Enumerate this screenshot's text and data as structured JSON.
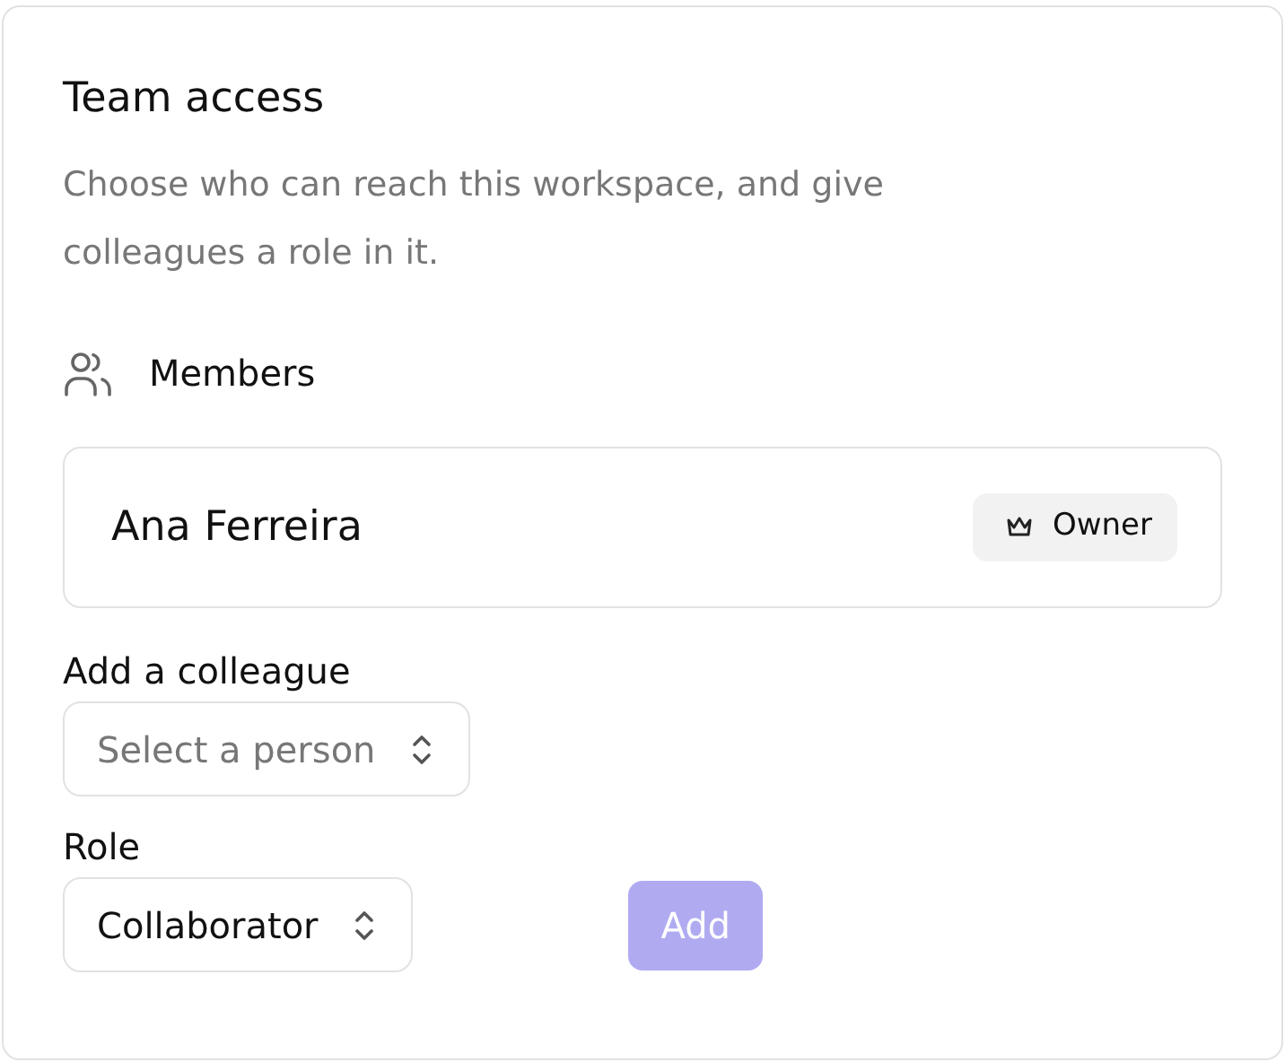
{
  "title": "Team access",
  "description": "Choose who can reach this workspace, and give colleagues a role in it.",
  "members_section": {
    "label": "Members",
    "members": [
      {
        "name": "Ana Ferreira",
        "badge": "Owner"
      }
    ]
  },
  "add_colleague": {
    "label": "Add a colleague",
    "placeholder": "Select a person"
  },
  "role": {
    "label": "Role",
    "value": "Collaborator"
  },
  "add_button": {
    "label": "Add",
    "disabled": true
  }
}
